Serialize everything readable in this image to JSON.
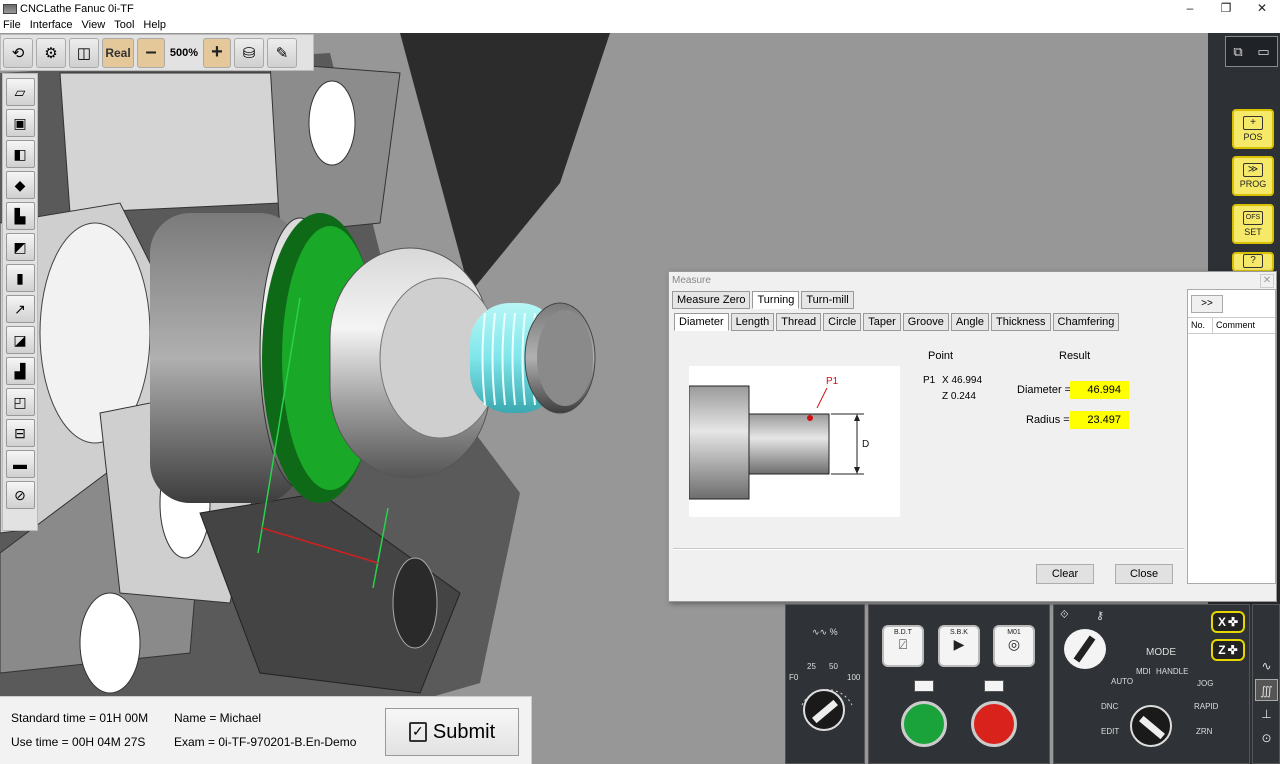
{
  "window": {
    "title": "CNCLathe Fanuc 0i-TF",
    "controls": [
      "–",
      "❐",
      "✕"
    ]
  },
  "menu": [
    "File",
    "Interface",
    "View",
    "Tool",
    "Help"
  ],
  "toolbar": {
    "real_label": "Real",
    "minus_label": "–",
    "zoom": "500%",
    "plus_label": "+"
  },
  "right_panel": {
    "buttons": [
      {
        "label": "POS",
        "icon": "+"
      },
      {
        "label": "PROG",
        "icon": "≫"
      },
      {
        "label": "SET",
        "icon": "OFS"
      },
      {
        "label": "",
        "icon": "?"
      }
    ]
  },
  "measure": {
    "title": "Measure",
    "tabs1": [
      "Measure Zero",
      "Turning",
      "Turn-mill"
    ],
    "tabs1_active": 1,
    "tabs2": [
      "Diameter",
      "Length",
      "Thread",
      "Circle",
      "Taper",
      "Groove",
      "Angle",
      "Thickness",
      "Chamfering"
    ],
    "tabs2_active": 0,
    "figure": {
      "point_label": "P1",
      "dim_label": "D"
    },
    "point_header": "Point",
    "result_header": "Result",
    "point_name": "P1",
    "point_x": "X 46.994",
    "point_z": "Z 0.244",
    "diameter_label": "Diameter =",
    "diameter_value": "46.994",
    "radius_label": "Radius =",
    "radius_value": "23.497",
    "clear_label": "Clear",
    "close_label": "Close",
    "side": {
      "more_label": ">>",
      "col_no": "No.",
      "col_comment": "Comment"
    }
  },
  "info": {
    "standard_time": "Standard time = 01H 00M",
    "use_time": "Use time = 00H 04M 27S",
    "name": "Name = Michael",
    "exam": "Exam = 0i-TF-970201-B.En-Demo",
    "submit_label": "Submit"
  },
  "feed_panel": {
    "label": "∿∿ %",
    "scale": [
      "F0",
      "25",
      "50",
      "100"
    ]
  },
  "cycle_panel": {
    "bdt": "B.D.T",
    "sbk": "S.B.K",
    "m01": "M01"
  },
  "mode_panel": {
    "title": "MODE",
    "auto": "AUTO",
    "mdi": "MDI",
    "handle": "HANDLE",
    "jog": "JOG",
    "dnc": "DNC",
    "rapid": "RAPID",
    "edit": "EDIT",
    "zrn": "ZRN",
    "x_axis": "X",
    "z_axis": "Z"
  },
  "colors": {
    "accent_yellow": "#ffff00",
    "cycle_start": "#1aa33a",
    "feed_hold": "#d9221b",
    "panel_bg": "#2f3237"
  }
}
